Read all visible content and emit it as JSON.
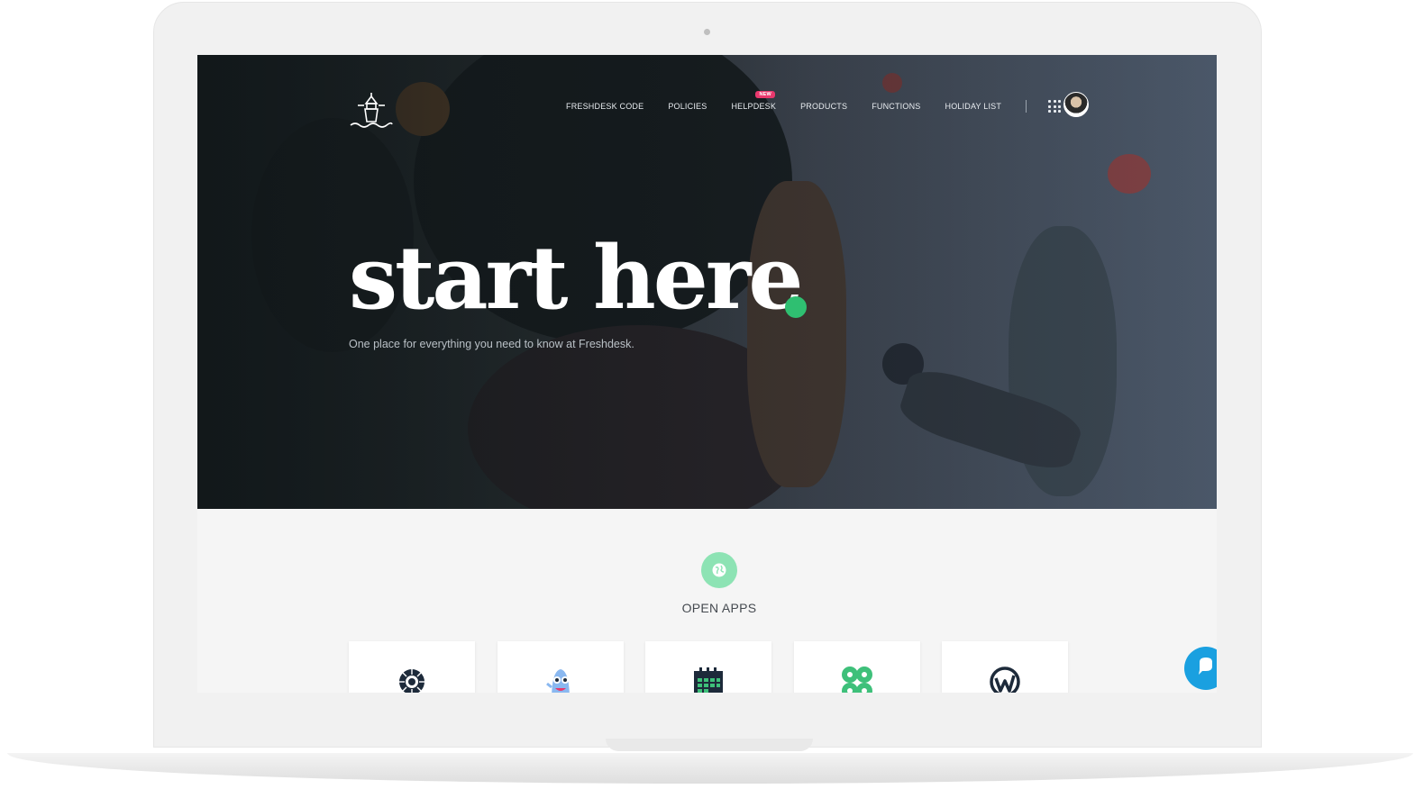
{
  "nav": {
    "items": [
      {
        "label": "FRESHDESK CODE"
      },
      {
        "label": "POLICIES"
      },
      {
        "label": "HELPDESK",
        "badge": "NEW"
      },
      {
        "label": "PRODUCTS"
      },
      {
        "label": "FUNCTIONS"
      },
      {
        "label": "HOLIDAY LIST"
      }
    ],
    "apps_icon": "grid-icon",
    "avatar": "user-avatar"
  },
  "logo": "lighthouse-logo",
  "hero": {
    "headline": "start here",
    "subtitle": "One place for everything you need to know at Freshdesk.",
    "accent_color": "#2fbf71"
  },
  "apps": {
    "icon": "globe-icon",
    "title": "OPEN APPS",
    "cards": [
      {
        "icon": "sunburst-icon"
      },
      {
        "icon": "mascot-icon"
      },
      {
        "icon": "calendar-icon"
      },
      {
        "icon": "command-icon"
      },
      {
        "icon": "workplace-icon"
      }
    ]
  },
  "chat": {
    "icon": "chat-icon",
    "color": "#1aa0e0"
  }
}
